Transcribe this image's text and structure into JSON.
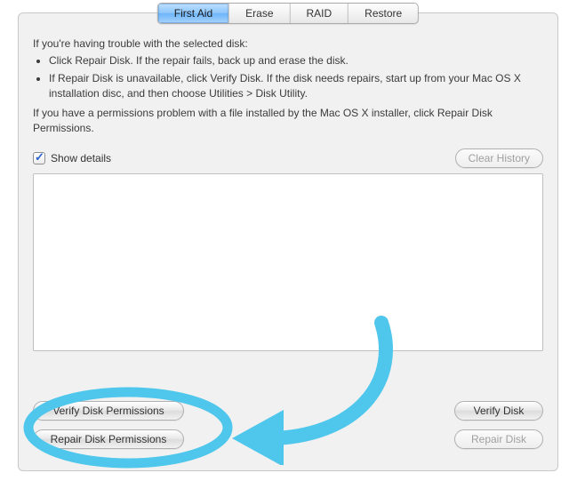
{
  "tabs": {
    "first_aid": "First Aid",
    "erase": "Erase",
    "raid": "RAID",
    "restore": "Restore"
  },
  "text": {
    "intro_lead": "If you're having trouble with the selected disk:",
    "bullet1": "Click Repair Disk. If the repair fails, back up and erase the disk.",
    "bullet2": "If Repair Disk is unavailable, click Verify Disk. If the disk needs repairs, start up from your Mac OS X installation disc, and then choose Utilities > Disk Utility.",
    "perm_note": "If you have a permissions problem with a file installed by the Mac OS X installer, click Repair Disk Permissions."
  },
  "controls": {
    "show_details": "Show details",
    "clear_history": "Clear History",
    "verify_disk_permissions": "Verify Disk Permissions",
    "repair_disk_permissions": "Repair Disk Permissions",
    "verify_disk": "Verify Disk",
    "repair_disk": "Repair Disk"
  },
  "annotation_color": "#4fc7ec"
}
